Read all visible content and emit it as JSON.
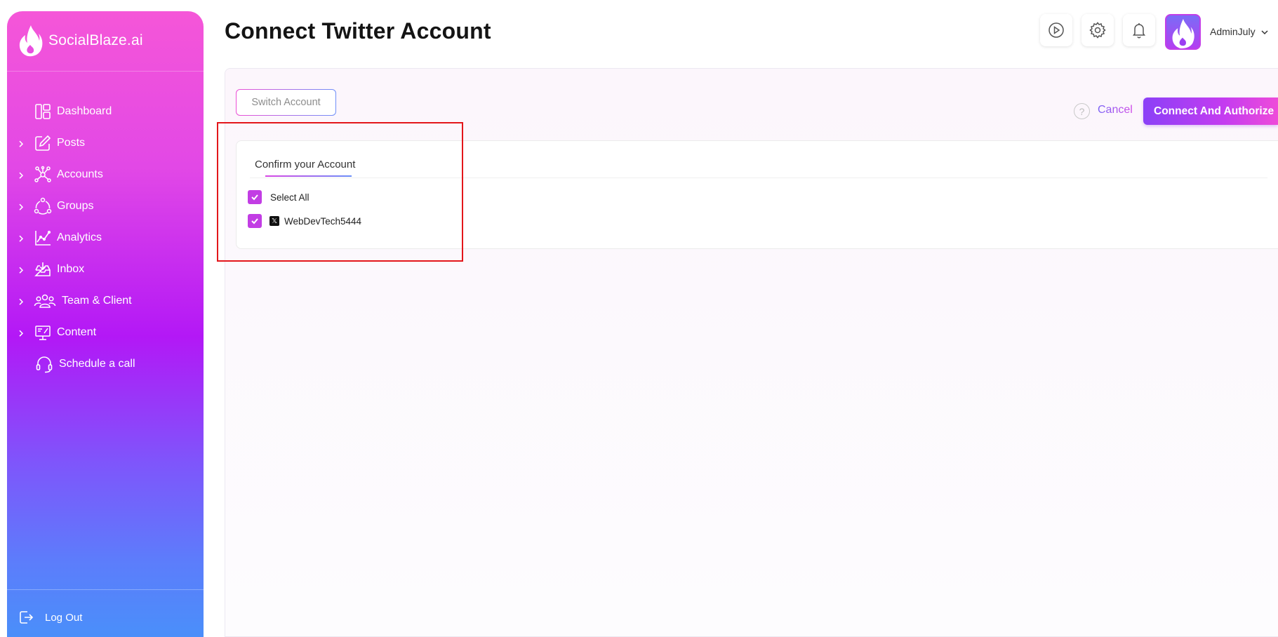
{
  "brand": {
    "name": "SocialBlaze.ai"
  },
  "sidebar": {
    "items": [
      {
        "label": "Dashboard",
        "icon": "dashboard-icon",
        "expandable": false
      },
      {
        "label": "Posts",
        "icon": "edit-icon",
        "expandable": true
      },
      {
        "label": "Accounts",
        "icon": "network-icon",
        "expandable": true
      },
      {
        "label": "Groups",
        "icon": "group-icon",
        "expandable": true
      },
      {
        "label": "Analytics",
        "icon": "analytics-icon",
        "expandable": true
      },
      {
        "label": "Inbox",
        "icon": "inbox-icon",
        "expandable": true
      },
      {
        "label": "Team & Client",
        "icon": "team-icon",
        "expandable": true
      },
      {
        "label": "Content",
        "icon": "content-icon",
        "expandable": true
      },
      {
        "label": "Schedule a call",
        "icon": "headset-icon",
        "expandable": false
      }
    ],
    "logout_label": "Log Out"
  },
  "header": {
    "title": "Connect Twitter Account",
    "user_name": "AdminJuly",
    "icons": [
      "play-icon",
      "gear-icon",
      "bell-icon"
    ]
  },
  "actions": {
    "switch_account": "Switch Account",
    "help": "?",
    "cancel": "Cancel",
    "connect": "Connect And Authorize"
  },
  "confirm": {
    "title": "Confirm your Account",
    "select_all": "Select All",
    "accounts": [
      {
        "platform_icon": "x-logo-icon",
        "platform_glyph": "𝕏",
        "name": "WebDevTech5444",
        "checked": true
      }
    ],
    "select_all_checked": true
  },
  "colors": {
    "accent": "#c23de4",
    "highlight_box": "#e3161b"
  }
}
